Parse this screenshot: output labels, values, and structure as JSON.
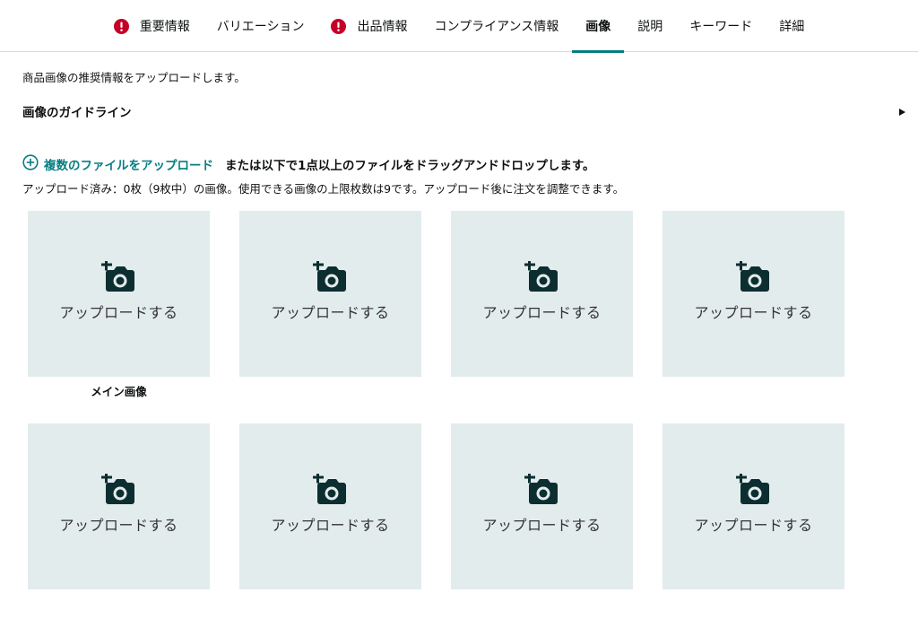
{
  "tabs": [
    {
      "label": "重要情報",
      "alert": true,
      "active": false
    },
    {
      "label": "バリエーション",
      "alert": false,
      "active": false
    },
    {
      "label": "出品情報",
      "alert": true,
      "active": false
    },
    {
      "label": "コンプライアンス情報",
      "alert": false,
      "active": false
    },
    {
      "label": "画像",
      "alert": false,
      "active": true
    },
    {
      "label": "説明",
      "alert": false,
      "active": false
    },
    {
      "label": "キーワード",
      "alert": false,
      "active": false
    },
    {
      "label": "詳細",
      "alert": false,
      "active": false
    }
  ],
  "intro_text": "商品画像の推奨情報をアップロードします。",
  "guidelines": {
    "title": "画像のガイドライン"
  },
  "upload": {
    "link_label": "複数のファイルをアップロード",
    "drop_text": "または以下で1点以上のファイルをドラッグアンドドロップします。",
    "status_text": "アップロード済み：0枚（9枚中）の画像。使用できる画像の上限枚数は9です。アップロード後に注文を調整できます。"
  },
  "slots": [
    {
      "label": "アップロードする"
    },
    {
      "label": "アップロードする"
    },
    {
      "label": "アップロードする"
    },
    {
      "label": "アップロードする"
    },
    {
      "label": "アップロードする"
    },
    {
      "label": "アップロードする"
    },
    {
      "label": "アップロードする"
    },
    {
      "label": "アップロードする"
    }
  ],
  "main_image_label": "メイン画像",
  "colors": {
    "accent": "#067d83",
    "alert": "#c40028",
    "slot_bg": "#e3ecec",
    "icon_dark": "#0d2e30"
  },
  "icons": {
    "alert": "exclamation-circle-icon",
    "caret": "caret-right-icon",
    "upload": "plus-circle-icon",
    "slot": "add-photo-camera-icon"
  }
}
